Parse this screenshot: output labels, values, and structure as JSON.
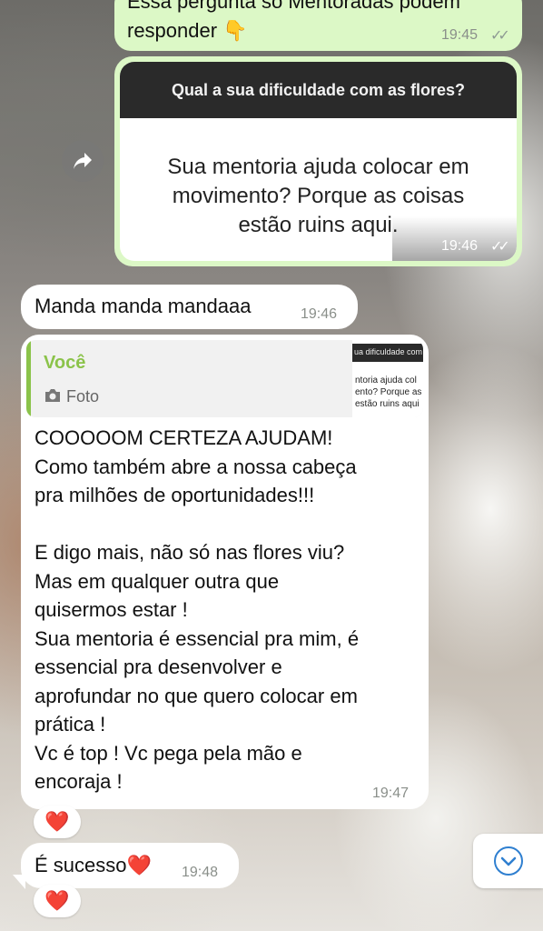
{
  "messages": {
    "m1": {
      "text": "Essa pergunta só Mentoradas podem\nresponder 👇",
      "time": "19:45"
    },
    "m2": {
      "image_header": "Qual a sua dificuldade com as flores?",
      "image_body": "Sua mentoria ajuda colocar em\nmovimento? Porque as coisas\nestão ruins aqui.",
      "time": "19:46"
    },
    "m3": {
      "text": "Manda manda mandaaa",
      "time": "19:46"
    },
    "m4": {
      "quote_author": "Você",
      "quote_type": "Foto",
      "thumb_header": "ua dificuldade com a",
      "thumb_body": "ntoria ajuda col\nento? Porque as\nestão ruins aqui",
      "text": "COOOOOM CERTEZA AJUDAM!\nComo também abre a nossa cabeça\npra milhões de oportunidades!!!\n\nE digo mais, não só nas flores viu?\nMas em qualquer outra que\nquisermos estar !\nSua mentoria é essencial pra mim, é\nessencial pra desenvolver e\naprofundar no que quero colocar em\nprática !\nVc é top ! Vc pega pela mão e\nencoraja !",
      "time": "19:47",
      "reaction": "❤️"
    },
    "m5": {
      "text": "É sucesso❤️",
      "time": "19:48",
      "reaction": "❤️"
    }
  },
  "colors": {
    "outgoing": "#dcf8c6",
    "incoming": "#ffffff",
    "quote_author": "#8bc34a",
    "check": "#8e9a93",
    "scroll_icon": "#2f7fd0"
  },
  "icons": {
    "forward": "forward-arrow-icon",
    "camera": "camera-icon",
    "read": "double-check-icon",
    "scroll": "chevron-down-icon"
  }
}
